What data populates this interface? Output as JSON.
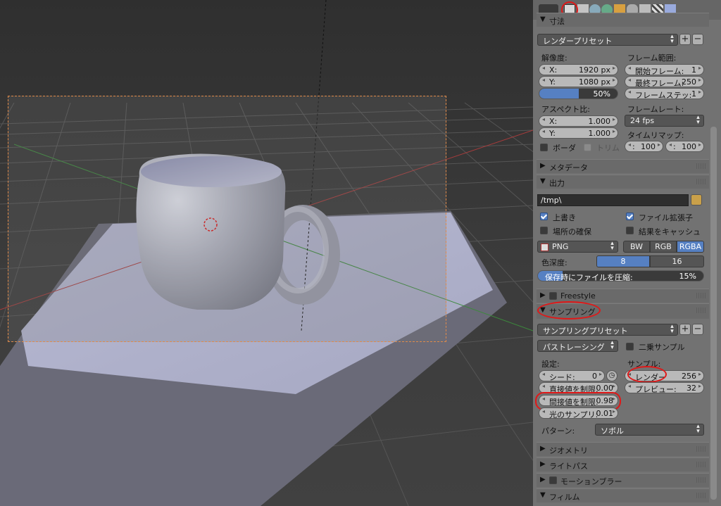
{
  "dimensions": {
    "section_label": "寸法",
    "render_preset": "レンダープリセット",
    "resolution_label": "解像度:",
    "res_x_label": "X:",
    "res_x_value": "1920 px",
    "res_y_label": "Y:",
    "res_y_value": "1080 px",
    "res_percent": "50%",
    "res_percent_fraction": 0.5,
    "aspect_label": "アスペクト比:",
    "aspect_x_label": "X:",
    "aspect_x_value": "1.000",
    "aspect_y_label": "Y:",
    "aspect_y_value": "1.000",
    "border_label": "ボーダ",
    "crop_label": "トリム",
    "frame_range_label": "フレーム範囲:",
    "start_frame_label": "開始フレーム:",
    "start_frame_value": "1",
    "end_frame_label": "最終フレーム:",
    "end_frame_value": "250",
    "frame_step_label": "フレームステッ:",
    "frame_step_value": "1",
    "frame_rate_label": "フレームレート:",
    "frame_rate_value": "24 fps",
    "time_remap_label": "タイムリマップ:",
    "remap_old": "100",
    "remap_new": "100"
  },
  "metadata": {
    "section_label": "メタデータ"
  },
  "output": {
    "section_label": "出力",
    "path": "/tmp\\",
    "overwrite_label": "上書き",
    "file_ext_label": "ファイル拡張子",
    "placeholders_label": "場所の確保",
    "cache_result_label": "結果をキャッシュ",
    "format": "PNG",
    "color_modes": [
      "BW",
      "RGB",
      "RGBA"
    ],
    "color_depth_label": "色深度:",
    "color_depths": [
      "8",
      "16"
    ],
    "compression_label": "保存時にファイルを圧縮:",
    "compression_value": "15%",
    "compression_fraction": 0.15
  },
  "freestyle": {
    "section_label": "Freestyle"
  },
  "sampling": {
    "section_label": "サンプリング",
    "preset": "サンプリングプリセット",
    "integrator": "パストレーシング",
    "square_samples_label": "二乗サンプル",
    "settings_label": "設定:",
    "seed_label": "シード:",
    "seed_value": "0",
    "clamp_direct_label": "直接値を制限:",
    "clamp_direct_value": "0.00",
    "clamp_indirect_label": "間接値を制限:",
    "clamp_indirect_value": "0.98",
    "light_sampling_label": "光のサンプリ:",
    "light_sampling_value": "0.01",
    "samples_label": "サンプル:",
    "render_label": "レンダー",
    "render_value": "256",
    "preview_label": "プレビュー:",
    "preview_value": "32",
    "pattern_label": "パターン:",
    "pattern_value": "ソボル"
  },
  "collapsed_sections": {
    "geometry": "ジオメトリ",
    "light_paths": "ライトパス",
    "motion_blur": "モーションブラー",
    "film": "フィルム"
  },
  "colors": {
    "accent_blue": "#5680c2",
    "annotation_red": "#e01818",
    "camera_frame": "#e08a4a"
  }
}
